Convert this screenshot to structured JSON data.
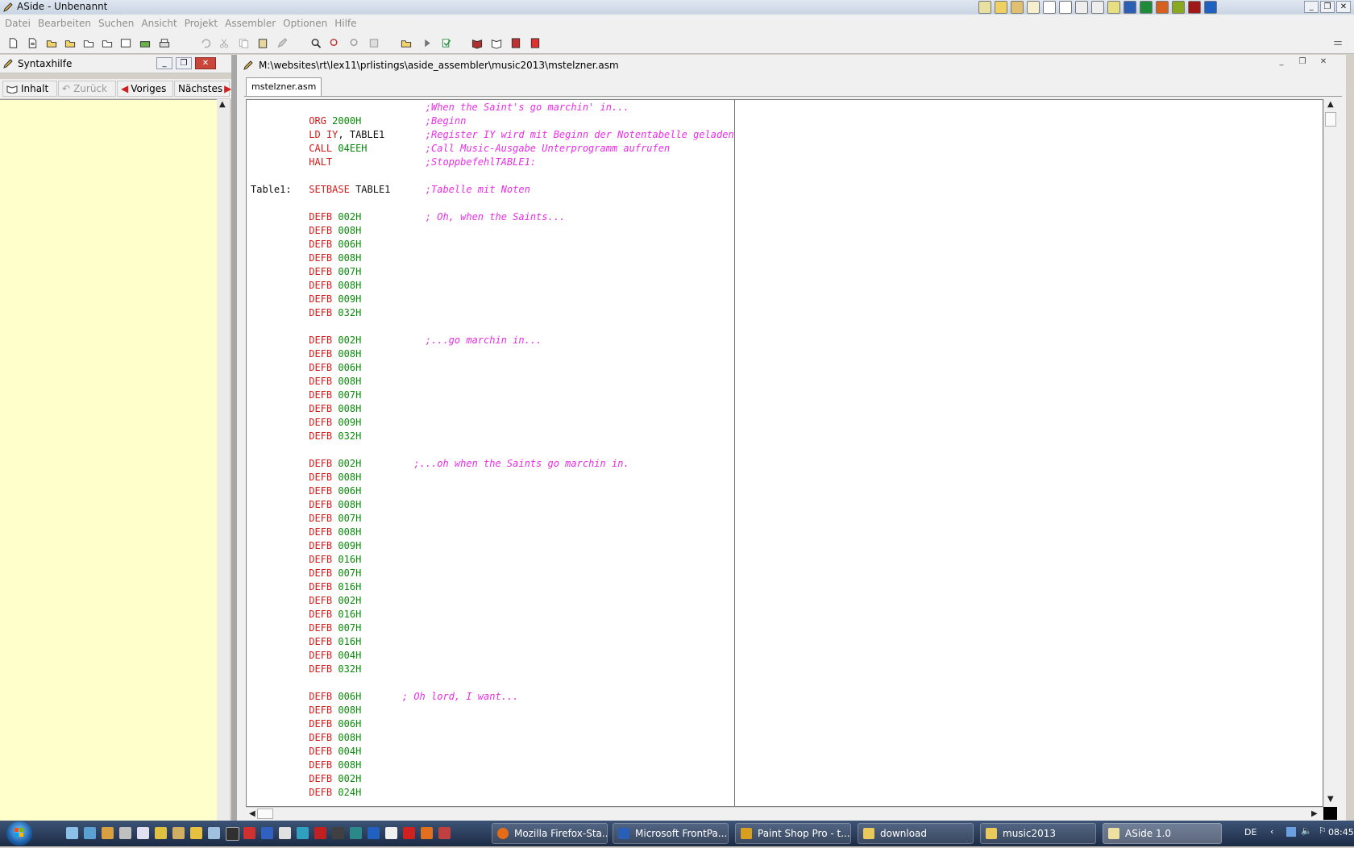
{
  "window": {
    "title": "ASide - Unbenannt"
  },
  "menu": [
    "Datei",
    "Bearbeiten",
    "Suchen",
    "Ansicht",
    "Projekt",
    "Assembler",
    "Optionen",
    "Hilfe"
  ],
  "syntax_pane": {
    "title": "Syntaxhilfe",
    "nav": {
      "contents": "Inhalt",
      "back": "Zurück",
      "prev": "Voriges",
      "next": "Nächstes"
    }
  },
  "editor": {
    "path": "M:\\websites\\rt\\lex11\\prlistings\\aside_assembler\\music2013\\mstelzner.asm",
    "tab": "mstelzner.asm",
    "lines": [
      {
        "label": "",
        "op": "",
        "arg": "",
        "arg2": "",
        "comment": ";When the Saint's go marchin' in...",
        "cpad": 0
      },
      {
        "label": "",
        "op": "ORG",
        "arg": "2000H",
        "arg2": "",
        "comment": ";Beginn",
        "cpad": 0
      },
      {
        "label": "",
        "op": "LD",
        "arg": "IY",
        "arg2": ", TABLE1",
        "comment": ";Register IY wird mit Beginn der Notentabelle geladen",
        "cpad": 0
      },
      {
        "label": "",
        "op": "CALL",
        "arg": "04EEH",
        "arg2": "",
        "comment": ";Call Music-Ausgabe Unterprogramm aufrufen",
        "cpad": 0
      },
      {
        "label": "",
        "op": "HALT",
        "arg": "",
        "arg2": "",
        "comment": ";StoppbefehlTABLE1:",
        "cpad": 0
      },
      {
        "label": "",
        "op": "",
        "arg": "",
        "arg2": "",
        "comment": "",
        "cpad": 0
      },
      {
        "label": "Table1:",
        "op": "SETBASE",
        "arg": "",
        "arg2": "TABLE1",
        "comment": ";Tabelle mit Noten",
        "cpad": 0
      },
      {
        "label": "",
        "op": "",
        "arg": "",
        "arg2": "",
        "comment": "",
        "cpad": 0
      },
      {
        "label": "",
        "op": "DEFB",
        "arg": "002H",
        "arg2": "",
        "comment": "; Oh, when the Saints...",
        "cpad": 0
      },
      {
        "label": "",
        "op": "DEFB",
        "arg": "008H",
        "arg2": "",
        "comment": "",
        "cpad": 0
      },
      {
        "label": "",
        "op": "DEFB",
        "arg": "006H",
        "arg2": "",
        "comment": "",
        "cpad": 0
      },
      {
        "label": "",
        "op": "DEFB",
        "arg": "008H",
        "arg2": "",
        "comment": "",
        "cpad": 0
      },
      {
        "label": "",
        "op": "DEFB",
        "arg": "007H",
        "arg2": "",
        "comment": "",
        "cpad": 0
      },
      {
        "label": "",
        "op": "DEFB",
        "arg": "008H",
        "arg2": "",
        "comment": "",
        "cpad": 0
      },
      {
        "label": "",
        "op": "DEFB",
        "arg": "009H",
        "arg2": "",
        "comment": "",
        "cpad": 0
      },
      {
        "label": "",
        "op": "DEFB",
        "arg": "032H",
        "arg2": "",
        "comment": "",
        "cpad": 0
      },
      {
        "label": "",
        "op": "",
        "arg": "",
        "arg2": "",
        "comment": "",
        "cpad": 0
      },
      {
        "label": "",
        "op": "DEFB",
        "arg": "002H",
        "arg2": "",
        "comment": ";...go marchin in...",
        "cpad": 0
      },
      {
        "label": "",
        "op": "DEFB",
        "arg": "008H",
        "arg2": "",
        "comment": "",
        "cpad": 0
      },
      {
        "label": "",
        "op": "DEFB",
        "arg": "006H",
        "arg2": "",
        "comment": "",
        "cpad": 0
      },
      {
        "label": "",
        "op": "DEFB",
        "arg": "008H",
        "arg2": "",
        "comment": "",
        "cpad": 0
      },
      {
        "label": "",
        "op": "DEFB",
        "arg": "007H",
        "arg2": "",
        "comment": "",
        "cpad": 0
      },
      {
        "label": "",
        "op": "DEFB",
        "arg": "008H",
        "arg2": "",
        "comment": "",
        "cpad": 0
      },
      {
        "label": "",
        "op": "DEFB",
        "arg": "009H",
        "arg2": "",
        "comment": "",
        "cpad": 0
      },
      {
        "label": "",
        "op": "DEFB",
        "arg": "032H",
        "arg2": "",
        "comment": "",
        "cpad": 0
      },
      {
        "label": "",
        "op": "",
        "arg": "",
        "arg2": "",
        "comment": "",
        "cpad": 0
      },
      {
        "label": "",
        "op": "DEFB",
        "arg": "002H",
        "arg2": "",
        "comment": ";...oh when the Saints go marchin in.",
        "cpad": -2
      },
      {
        "label": "",
        "op": "DEFB",
        "arg": "008H",
        "arg2": "",
        "comment": "",
        "cpad": 0
      },
      {
        "label": "",
        "op": "DEFB",
        "arg": "006H",
        "arg2": "",
        "comment": "",
        "cpad": 0
      },
      {
        "label": "",
        "op": "DEFB",
        "arg": "008H",
        "arg2": "",
        "comment": "",
        "cpad": 0
      },
      {
        "label": "",
        "op": "DEFB",
        "arg": "007H",
        "arg2": "",
        "comment": "",
        "cpad": 0
      },
      {
        "label": "",
        "op": "DEFB",
        "arg": "008H",
        "arg2": "",
        "comment": "",
        "cpad": 0
      },
      {
        "label": "",
        "op": "DEFB",
        "arg": "009H",
        "arg2": "",
        "comment": "",
        "cpad": 0
      },
      {
        "label": "",
        "op": "DEFB",
        "arg": "016H",
        "arg2": "",
        "comment": "",
        "cpad": 0
      },
      {
        "label": "",
        "op": "DEFB",
        "arg": "007H",
        "arg2": "",
        "comment": "",
        "cpad": 0
      },
      {
        "label": "",
        "op": "DEFB",
        "arg": "016H",
        "arg2": "",
        "comment": "",
        "cpad": 0
      },
      {
        "label": "",
        "op": "DEFB",
        "arg": "002H",
        "arg2": "",
        "comment": "",
        "cpad": 0
      },
      {
        "label": "",
        "op": "DEFB",
        "arg": "016H",
        "arg2": "",
        "comment": "",
        "cpad": 0
      },
      {
        "label": "",
        "op": "DEFB",
        "arg": "007H",
        "arg2": "",
        "comment": "",
        "cpad": 0
      },
      {
        "label": "",
        "op": "DEFB",
        "arg": "016H",
        "arg2": "",
        "comment": "",
        "cpad": 0
      },
      {
        "label": "",
        "op": "DEFB",
        "arg": "004H",
        "arg2": "",
        "comment": "",
        "cpad": 0
      },
      {
        "label": "",
        "op": "DEFB",
        "arg": "032H",
        "arg2": "",
        "comment": "",
        "cpad": 0
      },
      {
        "label": "",
        "op": "",
        "arg": "",
        "arg2": "",
        "comment": "",
        "cpad": 0
      },
      {
        "label": "",
        "op": "DEFB",
        "arg": "006H",
        "arg2": "",
        "comment": "; Oh lord, I want...",
        "cpad": -4
      },
      {
        "label": "",
        "op": "DEFB",
        "arg": "008H",
        "arg2": "",
        "comment": "",
        "cpad": 0
      },
      {
        "label": "",
        "op": "DEFB",
        "arg": "006H",
        "arg2": "",
        "comment": "",
        "cpad": 0
      },
      {
        "label": "",
        "op": "DEFB",
        "arg": "008H",
        "arg2": "",
        "comment": "",
        "cpad": 0
      },
      {
        "label": "",
        "op": "DEFB",
        "arg": "004H",
        "arg2": "",
        "comment": "",
        "cpad": 0
      },
      {
        "label": "",
        "op": "DEFB",
        "arg": "008H",
        "arg2": "",
        "comment": "",
        "cpad": 0
      },
      {
        "label": "",
        "op": "DEFB",
        "arg": "002H",
        "arg2": "",
        "comment": "",
        "cpad": 0
      },
      {
        "label": "",
        "op": "DEFB",
        "arg": "024H",
        "arg2": "",
        "comment": "",
        "cpad": 0
      }
    ]
  },
  "taskbar": {
    "tasks": [
      {
        "label": "Mozilla Firefox-Sta...",
        "color": "#e66b16"
      },
      {
        "label": "Microsoft FrontPa...",
        "color": "#2a5fb7"
      },
      {
        "label": "Paint Shop Pro - t...",
        "color": "#d9a020"
      },
      {
        "label": "download",
        "color": "#e8c95a"
      },
      {
        "label": "music2013",
        "color": "#e8c95a"
      },
      {
        "label": "ASide 1.0",
        "color": "#f0e0a0"
      }
    ],
    "lang": "DE",
    "clock": "08:45"
  },
  "icons": {
    "app": "pencil-icon",
    "colors": {
      "op": "#d41a1a",
      "num": "#0a8a0a",
      "comment": "#ea2ee6",
      "help_bg": "#ffffcc"
    }
  }
}
